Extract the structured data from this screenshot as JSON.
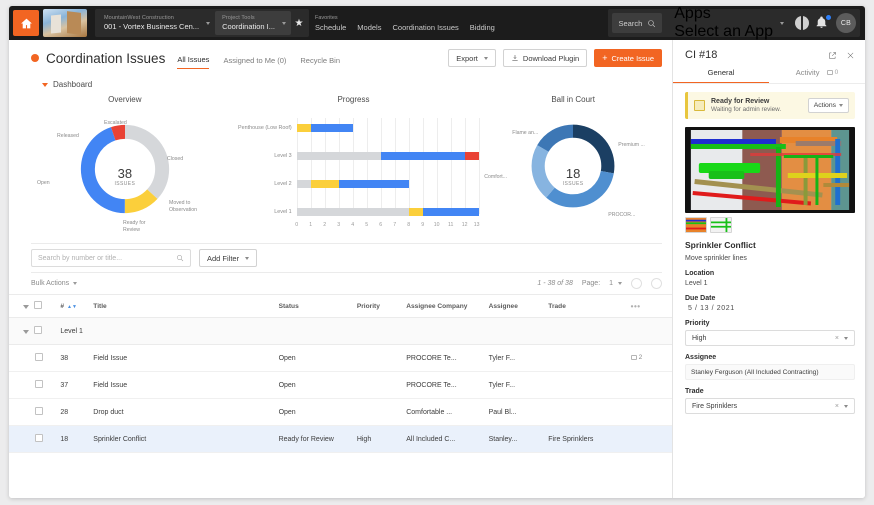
{
  "topnav": {
    "home_icon": "home-icon",
    "company_label": "MountainWest Construction",
    "company_value": "001 - Vortex Business Cen...",
    "tool_label": "Project Tools",
    "tool_value": "Coordination I...",
    "star_icon": "star-icon",
    "favorites_label": "Favorites",
    "favorites": [
      "Schedule",
      "Models",
      "Coordination Issues",
      "Bidding"
    ],
    "search_label": "Search",
    "search_icon": "search-icon",
    "apps_label": "Apps",
    "apps_value": "Select an App",
    "help_icon": "help-icon",
    "bell_icon": "bell-icon",
    "avatar_initials": "CB"
  },
  "toolbar": {
    "title": "Coordination Issues",
    "tabs": [
      {
        "label": "All Issues",
        "active": true
      },
      {
        "label": "Assigned to Me (0)",
        "active": false
      },
      {
        "label": "Recycle Bin",
        "active": false
      }
    ],
    "export_label": "Export",
    "download_label": "Download Plugin",
    "create_label": "Create Issue",
    "create_plus": "+"
  },
  "dashboard": {
    "section_label": "Dashboard"
  },
  "chart_data": [
    {
      "type": "pie",
      "title": "Overview",
      "center_value": "38",
      "center_label": "ISSUES",
      "labels": [
        "Closed",
        "Moved to Observation",
        "Ready for Review",
        "Open",
        "Released",
        "Escalated"
      ],
      "values": [
        13,
        1,
        5,
        17,
        1,
        1
      ],
      "colors": [
        "#d5d7da",
        "#d5d7da",
        "#fbcf3b",
        "#4285f4",
        "#4285f4",
        "#e94235"
      ],
      "legend": "callout"
    },
    {
      "type": "bar",
      "title": "Progress",
      "orientation": "horizontal",
      "categories": [
        "Penthouse (Low Roof)",
        "Level 3",
        "Level 2",
        "Level 1"
      ],
      "series": [
        {
          "name": "Closed",
          "color": "#d5d7da",
          "values": [
            0,
            6,
            1,
            8
          ]
        },
        {
          "name": "Ready for Review",
          "color": "#fbcf3b",
          "values": [
            1,
            0,
            2,
            1
          ]
        },
        {
          "name": "Open",
          "color": "#4285f4",
          "values": [
            3,
            6,
            5,
            4
          ]
        },
        {
          "name": "Escalated",
          "color": "#e94235",
          "values": [
            0,
            1,
            0,
            0
          ]
        }
      ],
      "xlabel": "",
      "ylabel": "",
      "xticks": [
        "0",
        "1",
        "2",
        "3",
        "4",
        "5",
        "6",
        "7",
        "8",
        "9",
        "10",
        "11",
        "12",
        "13"
      ],
      "xlim": [
        0,
        13
      ],
      "grid": true
    },
    {
      "type": "pie",
      "title": "Ball in Court",
      "center_value": "18",
      "center_label": "ISSUES",
      "labels": [
        "Premium ...",
        "PROCOR...",
        "Comfort...",
        "Flame an..."
      ],
      "values": [
        5,
        6,
        4,
        3
      ],
      "colors": [
        "#1b3f63",
        "#4f8fd0",
        "#87b4e0",
        "#3d77b5"
      ],
      "legend": "callout"
    }
  ],
  "filters": {
    "search_placeholder": "Search by number or title...",
    "search_value": "",
    "search_icon": "search-icon",
    "add_filter_label": "Add Filter"
  },
  "listbar": {
    "bulk_actions_label": "Bulk Actions",
    "range_label": "1 - 38 of 38",
    "page_label": "Page:",
    "page_value": "1"
  },
  "table": {
    "columns": [
      "",
      "#",
      "Title",
      "Status",
      "Priority",
      "Assignee Company",
      "Assignee",
      "Trade",
      ""
    ],
    "group_label": "Level 1",
    "rows": [
      {
        "num": "38",
        "title": "Field Issue",
        "status": "Open",
        "priority": "",
        "company": "PROCORE Te...",
        "assignee": "Tyler F...",
        "trade": "",
        "attachments": "2",
        "selected": false
      },
      {
        "num": "37",
        "title": "Field Issue",
        "status": "Open",
        "priority": "",
        "company": "PROCORE Te...",
        "assignee": "Tyler F...",
        "trade": "",
        "attachments": "",
        "selected": false
      },
      {
        "num": "28",
        "title": "Drop duct",
        "status": "Open",
        "priority": "",
        "company": "Comfortable ...",
        "assignee": "Paul Bl...",
        "trade": "",
        "attachments": "",
        "selected": false
      },
      {
        "num": "18",
        "title": "Sprinkler Conflict",
        "status": "Ready for Review",
        "priority": "High",
        "company": "All Included C...",
        "assignee": "Stanley...",
        "trade": "Fire Sprinklers",
        "attachments": "",
        "selected": true
      }
    ]
  },
  "panel": {
    "title": "CI #18",
    "expand_icon": "expand-icon",
    "close_icon": "close-icon",
    "tabs": [
      {
        "label": "General",
        "active": true
      },
      {
        "label": "Activity",
        "active": false,
        "count": "0"
      }
    ],
    "banner_title": "Ready for Review",
    "banner_text": "Waiting for admin review.",
    "banner_actions_label": "Actions",
    "issue_title": "Sprinkler Conflict",
    "issue_desc": "Move sprinkler lines",
    "location_label": "Location",
    "location_value": "Level 1",
    "due_date_label": "Due Date",
    "due_date_value": "5  /  13  /  2021",
    "priority_label": "Priority",
    "priority_value": "High",
    "assignee_label": "Assignee",
    "assignee_value": "Stanley Ferguson (All Included Contracting)",
    "trade_label": "Trade",
    "trade_value": "Fire Sprinklers"
  },
  "colors": {
    "accent": "#f26522",
    "open": "#4285f4",
    "review": "#fbcf3b",
    "closed": "#d5d7da",
    "escalated": "#e94235"
  }
}
